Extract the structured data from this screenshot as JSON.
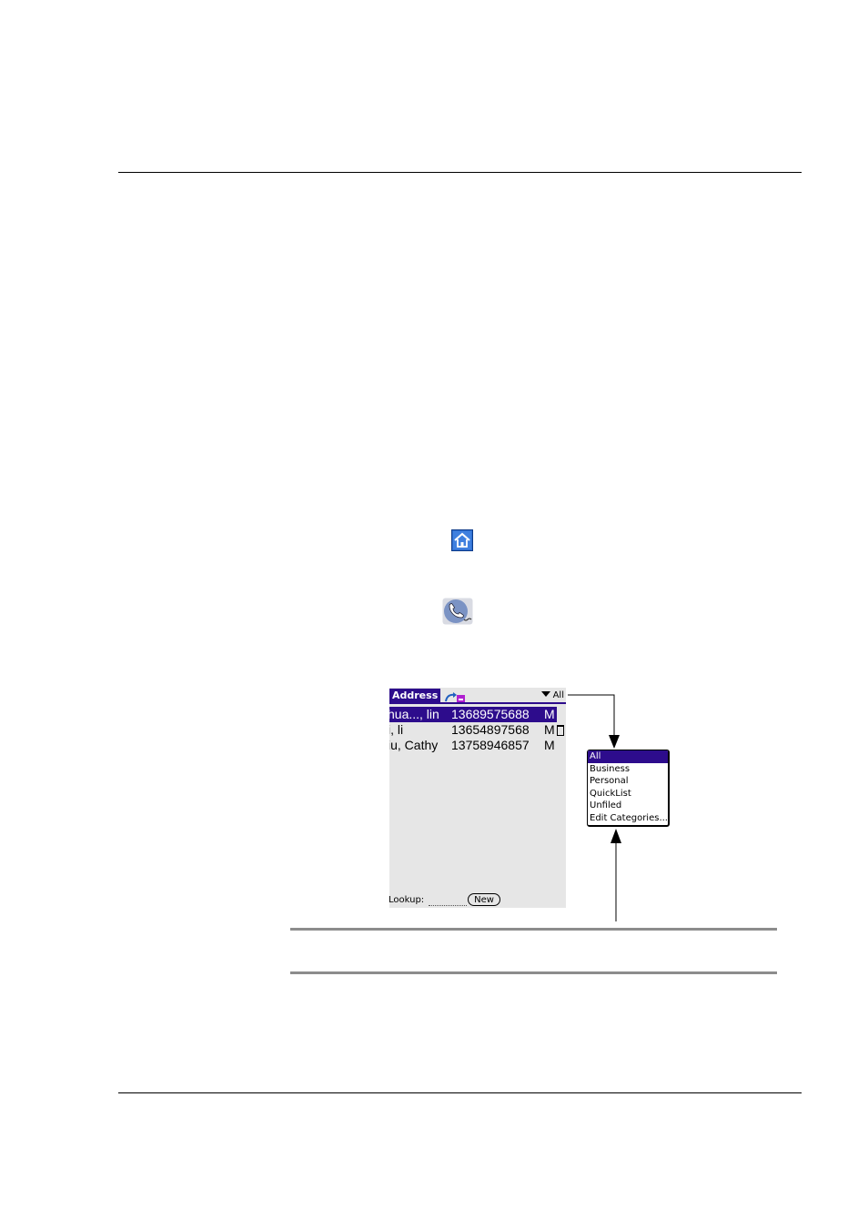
{
  "address_app": {
    "title": "Address",
    "category_selected": "All",
    "rows": [
      {
        "name": "hua..., lin",
        "phone": "13689575688",
        "type": "M",
        "selected": true,
        "note": false
      },
      {
        "name": "i, li",
        "phone": "13654897568",
        "type": "M",
        "selected": false,
        "note": true
      },
      {
        "name": "iu, Cathy",
        "phone": "13758946857",
        "type": "M",
        "selected": false,
        "note": false
      }
    ],
    "lookup_label": "Lookup:",
    "new_button": "New"
  },
  "category_popup": {
    "items": [
      "All",
      "Business",
      "Personal",
      "QuickList",
      "Unfiled",
      "Edit Categories..."
    ],
    "selected_index": 0
  },
  "icons": {
    "home": "home-icon",
    "phone": "phone-icon",
    "beam": "beam-icon"
  },
  "colors": {
    "palm_highlight": "#2d0c8c",
    "screen_background": "#e6e6e6",
    "home_icon_blue": "#1f5fbf"
  }
}
